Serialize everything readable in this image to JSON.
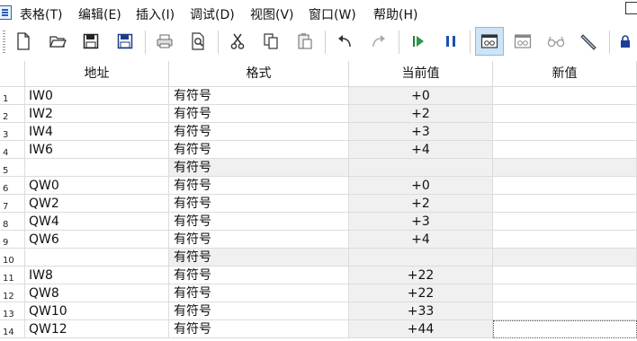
{
  "menu": {
    "items": [
      "表格(T)",
      "编辑(E)",
      "插入(I)",
      "调试(D)",
      "视图(V)",
      "窗口(W)",
      "帮助(H)"
    ]
  },
  "toolbar": {
    "buttons": [
      {
        "name": "new-file-icon"
      },
      {
        "name": "open-folder-icon"
      },
      {
        "name": "save-icon"
      },
      {
        "name": "save-all-icon"
      },
      {
        "name": "print-icon"
      },
      {
        "name": "print-preview-icon"
      },
      {
        "name": "cut-icon"
      },
      {
        "name": "copy-icon"
      },
      {
        "name": "paste-icon"
      },
      {
        "name": "undo-icon"
      },
      {
        "name": "redo-icon"
      },
      {
        "name": "run-icon"
      },
      {
        "name": "pause-icon"
      },
      {
        "name": "monitor-icon",
        "active": true
      },
      {
        "name": "monitor-trend-icon"
      },
      {
        "name": "glasses-icon"
      },
      {
        "name": "pencil-icon"
      },
      {
        "name": "lock-icon"
      }
    ]
  },
  "table": {
    "headers": {
      "addr": "地址",
      "fmt": "格式",
      "cur": "当前值",
      "new": "新值"
    },
    "rows": [
      {
        "num": "1",
        "addr": "IW0",
        "fmt": "有符号",
        "cur": "+0",
        "new": ""
      },
      {
        "num": "2",
        "addr": "IW2",
        "fmt": "有符号",
        "cur": "+2",
        "new": ""
      },
      {
        "num": "3",
        "addr": "IW4",
        "fmt": "有符号",
        "cur": "+3",
        "new": ""
      },
      {
        "num": "4",
        "addr": "IW6",
        "fmt": "有符号",
        "cur": "+4",
        "new": ""
      },
      {
        "num": "5",
        "addr": "",
        "fmt": "有符号",
        "cur": "",
        "new": "",
        "blank": true
      },
      {
        "num": "6",
        "addr": "QW0",
        "fmt": "有符号",
        "cur": "+0",
        "new": ""
      },
      {
        "num": "7",
        "addr": "QW2",
        "fmt": "有符号",
        "cur": "+2",
        "new": ""
      },
      {
        "num": "8",
        "addr": "QW4",
        "fmt": "有符号",
        "cur": "+3",
        "new": ""
      },
      {
        "num": "9",
        "addr": "QW6",
        "fmt": "有符号",
        "cur": "+4",
        "new": ""
      },
      {
        "num": "10",
        "addr": "",
        "fmt": "有符号",
        "cur": "",
        "new": "",
        "blank": true
      },
      {
        "num": "11",
        "addr": "IW8",
        "fmt": "有符号",
        "cur": "+22",
        "new": ""
      },
      {
        "num": "12",
        "addr": "QW8",
        "fmt": "有符号",
        "cur": "+22",
        "new": ""
      },
      {
        "num": "13",
        "addr": "QW10",
        "fmt": "有符号",
        "cur": "+33",
        "new": ""
      },
      {
        "num": "14",
        "addr": "QW12",
        "fmt": "有符号",
        "cur": "+44",
        "new": "",
        "focused": true
      }
    ]
  }
}
